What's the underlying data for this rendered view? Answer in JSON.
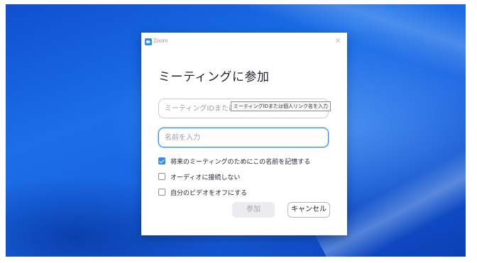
{
  "window": {
    "app_title": "Zoom",
    "close_icon": "close-icon",
    "app_icon": "zoom-logo-icon"
  },
  "dialog": {
    "heading": "ミーティングに参加",
    "meeting_id_placeholder": "ミーティングIDまたは個人リンク名を入力",
    "name_placeholder": "名前を入力",
    "tooltip": "ミーティングIDまたは個人リンク名を入力",
    "options": [
      {
        "label": "将来のミーティングのためにこの名前を記憶する",
        "checked": true
      },
      {
        "label": "オーディオに接続しない",
        "checked": false
      },
      {
        "label": "自分のビデオをオフにする",
        "checked": false
      }
    ],
    "join_label": "参加",
    "cancel_label": "キャンセル"
  },
  "colors": {
    "accent": "#2d8cff",
    "desktop_blue": "#1b6ee8"
  }
}
